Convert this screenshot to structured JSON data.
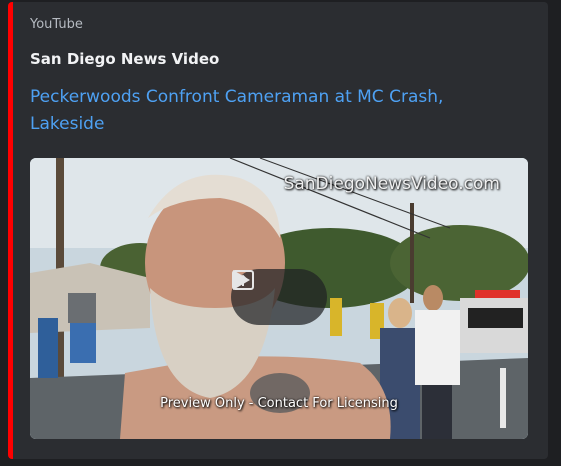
{
  "embed": {
    "provider": "YouTube",
    "author": "San Diego News Video",
    "title": "Peckerwoods Confront Cameraman at MC Crash, Lakeside",
    "accent_color": "#ff0000",
    "link_color": "#4ea1f3"
  },
  "thumbnail": {
    "watermark": "SanDiegoNewsVideo.com",
    "caption": "Preview Only - Contact For Licensing",
    "play_icon": "play-icon",
    "open_icon": "open-external-icon"
  }
}
